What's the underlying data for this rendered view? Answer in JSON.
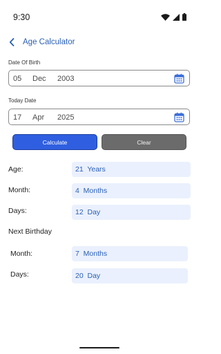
{
  "status": {
    "time": "9:30"
  },
  "app_bar": {
    "title": "Age Calculator"
  },
  "dob": {
    "label": "Date Of Birth",
    "day": "05",
    "month": "Dec",
    "year": "2003"
  },
  "today": {
    "label": "Today Date",
    "day": "17",
    "month": "Apr",
    "year": "2025"
  },
  "buttons": {
    "calculate": "Calculate",
    "clear": "Clear"
  },
  "results": {
    "age_label": "Age:",
    "age_value": "21  Years",
    "month_label": "Month:",
    "month_value": "4  Months",
    "days_label": "Days:",
    "days_value": "12  Day"
  },
  "next_birthday": {
    "title": "Next Birthday",
    "month_label": "Month:",
    "month_value": "7  Months",
    "days_label": "Days:",
    "days_value": "20  Day"
  },
  "colors": {
    "accent": "#2a5fb5",
    "primary_button": "#2f5fe0",
    "secondary_button": "#6b6b6b",
    "value_bg": "#eaf0fd"
  }
}
